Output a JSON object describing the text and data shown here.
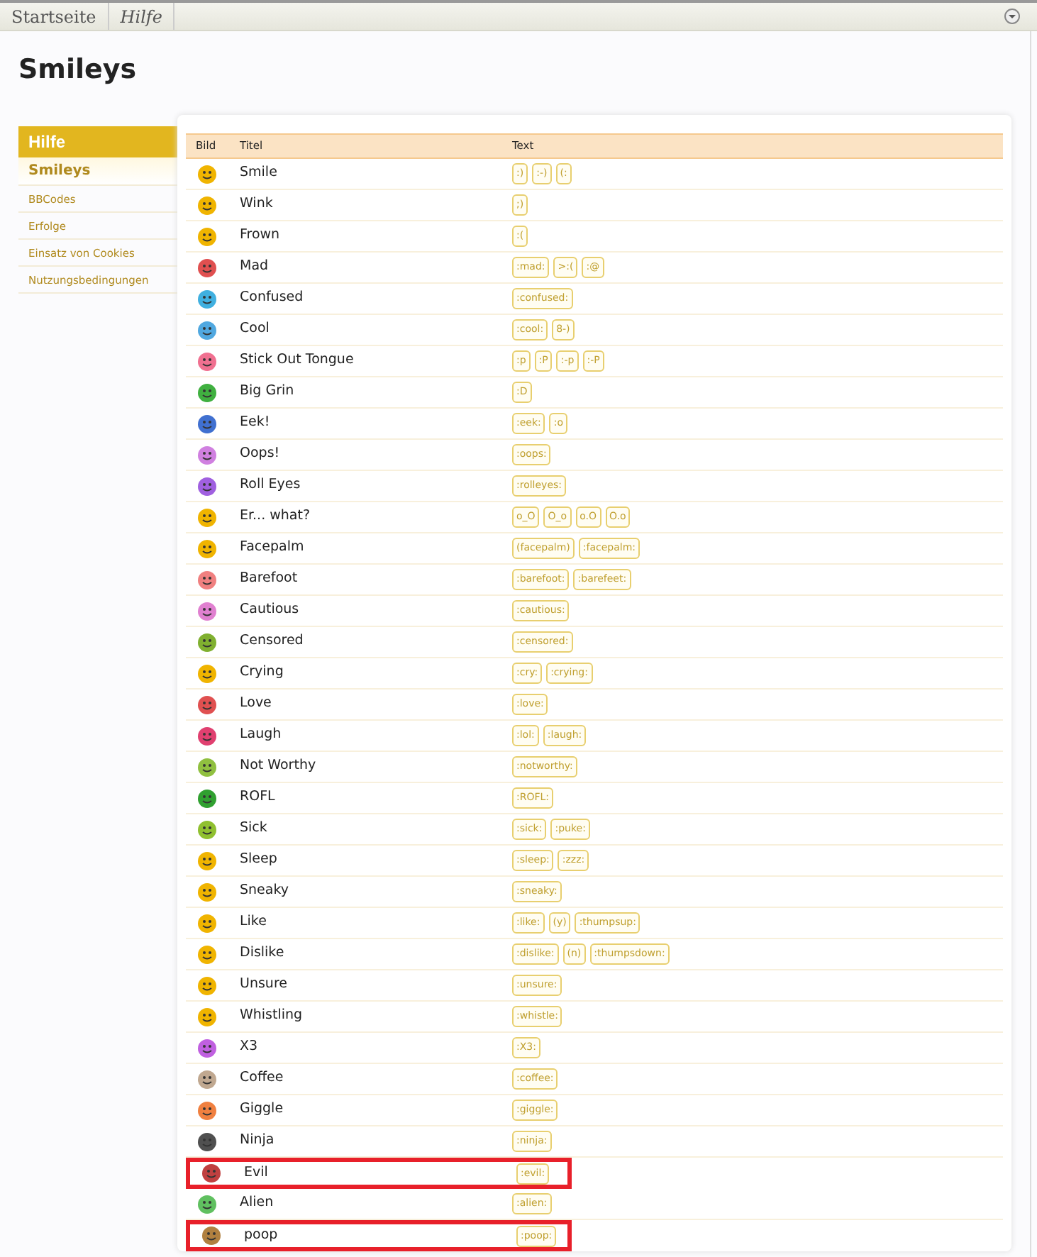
{
  "breadcrumb": [
    {
      "label": "Startseite",
      "current": false
    },
    {
      "label": "Hilfe",
      "current": true
    }
  ],
  "title": "Smileys",
  "sidebar": {
    "heading": "Hilfe",
    "items": [
      {
        "label": "Smileys",
        "selected": true
      },
      {
        "label": "BBCodes",
        "selected": false
      },
      {
        "label": "Erfolge",
        "selected": false
      },
      {
        "label": "Einsatz von Cookies",
        "selected": false
      },
      {
        "label": "Nutzungsbedingungen",
        "selected": false
      }
    ]
  },
  "table": {
    "columns": [
      "Bild",
      "Titel",
      "Text"
    ],
    "rows": [
      {
        "color": "#f0b400",
        "title": "Smile",
        "codes": [
          ":)",
          ":-)",
          "(:"
        ],
        "highlighted": false
      },
      {
        "color": "#f0b400",
        "title": "Wink",
        "codes": [
          ";)"
        ],
        "highlighted": false
      },
      {
        "color": "#f0b400",
        "title": "Frown",
        "codes": [
          ":("
        ],
        "highlighted": false
      },
      {
        "color": "#e05050",
        "title": "Mad",
        "codes": [
          ":mad:",
          ">:(",
          ":@"
        ],
        "highlighted": false
      },
      {
        "color": "#40b0e0",
        "title": "Confused",
        "codes": [
          ":confused:"
        ],
        "highlighted": false
      },
      {
        "color": "#50a8e0",
        "title": "Cool",
        "codes": [
          ":cool:",
          "8-)"
        ],
        "highlighted": false
      },
      {
        "color": "#f07090",
        "title": "Stick Out Tongue",
        "codes": [
          ":p",
          ":P",
          ":-p",
          ":-P"
        ],
        "highlighted": false
      },
      {
        "color": "#40b040",
        "title": "Big Grin",
        "codes": [
          ":D"
        ],
        "highlighted": false
      },
      {
        "color": "#4070d0",
        "title": "Eek!",
        "codes": [
          ":eek:",
          ":o"
        ],
        "highlighted": false
      },
      {
        "color": "#d080e0",
        "title": "Oops!",
        "codes": [
          ":oops:"
        ],
        "highlighted": false
      },
      {
        "color": "#a060e0",
        "title": "Roll Eyes",
        "codes": [
          ":rolleyes:"
        ],
        "highlighted": false
      },
      {
        "color": "#f0b400",
        "title": "Er... what?",
        "codes": [
          "o_O",
          "O_o",
          "o.O",
          "O.o"
        ],
        "highlighted": false
      },
      {
        "color": "#f0b400",
        "title": "Facepalm",
        "codes": [
          "(facepalm)",
          ":facepalm:"
        ],
        "highlighted": false
      },
      {
        "color": "#f08080",
        "title": "Barefoot",
        "codes": [
          ":barefoot:",
          ":barefeet:"
        ],
        "highlighted": false
      },
      {
        "color": "#e080d0",
        "title": "Cautious",
        "codes": [
          ":cautious:"
        ],
        "highlighted": false
      },
      {
        "color": "#80b030",
        "title": "Censored",
        "codes": [
          ":censored:"
        ],
        "highlighted": false
      },
      {
        "color": "#f0b400",
        "title": "Crying",
        "codes": [
          ":cry:",
          ":crying:"
        ],
        "highlighted": false
      },
      {
        "color": "#e05050",
        "title": "Love",
        "codes": [
          ":love:"
        ],
        "highlighted": false
      },
      {
        "color": "#e04070",
        "title": "Laugh",
        "codes": [
          ":lol:",
          ":laugh:"
        ],
        "highlighted": false
      },
      {
        "color": "#90c040",
        "title": "Not Worthy",
        "codes": [
          ":notworthy:"
        ],
        "highlighted": false
      },
      {
        "color": "#30a030",
        "title": "ROFL",
        "codes": [
          ":ROFL:"
        ],
        "highlighted": false
      },
      {
        "color": "#90c030",
        "title": "Sick",
        "codes": [
          ":sick:",
          ":puke:"
        ],
        "highlighted": false
      },
      {
        "color": "#f0b400",
        "title": "Sleep",
        "codes": [
          ":sleep:",
          ":zzz:"
        ],
        "highlighted": false
      },
      {
        "color": "#f0b400",
        "title": "Sneaky",
        "codes": [
          ":sneaky:"
        ],
        "highlighted": false
      },
      {
        "color": "#f0b400",
        "title": "Like",
        "codes": [
          ":like:",
          "(y)",
          ":thumpsup:"
        ],
        "highlighted": false
      },
      {
        "color": "#f0b400",
        "title": "Dislike",
        "codes": [
          ":dislike:",
          "(n)",
          ":thumpsdown:"
        ],
        "highlighted": false
      },
      {
        "color": "#f0b400",
        "title": "Unsure",
        "codes": [
          ":unsure:"
        ],
        "highlighted": false
      },
      {
        "color": "#f0b400",
        "title": "Whistling",
        "codes": [
          ":whistle:"
        ],
        "highlighted": false
      },
      {
        "color": "#c060e0",
        "title": "X3",
        "codes": [
          ":X3:"
        ],
        "highlighted": false
      },
      {
        "color": "#c0a890",
        "title": "Coffee",
        "codes": [
          ":coffee:"
        ],
        "highlighted": false
      },
      {
        "color": "#f08040",
        "title": "Giggle",
        "codes": [
          ":giggle:"
        ],
        "highlighted": false
      },
      {
        "color": "#505050",
        "title": "Ninja",
        "codes": [
          ":ninja:"
        ],
        "highlighted": false
      },
      {
        "color": "#c04040",
        "title": "Evil",
        "codes": [
          ":evil:"
        ],
        "highlighted": true
      },
      {
        "color": "#60c060",
        "title": "Alien",
        "codes": [
          ":alien:"
        ],
        "highlighted": false
      },
      {
        "color": "#b08040",
        "title": "poop",
        "codes": [
          ":poop:"
        ],
        "highlighted": true
      }
    ]
  }
}
